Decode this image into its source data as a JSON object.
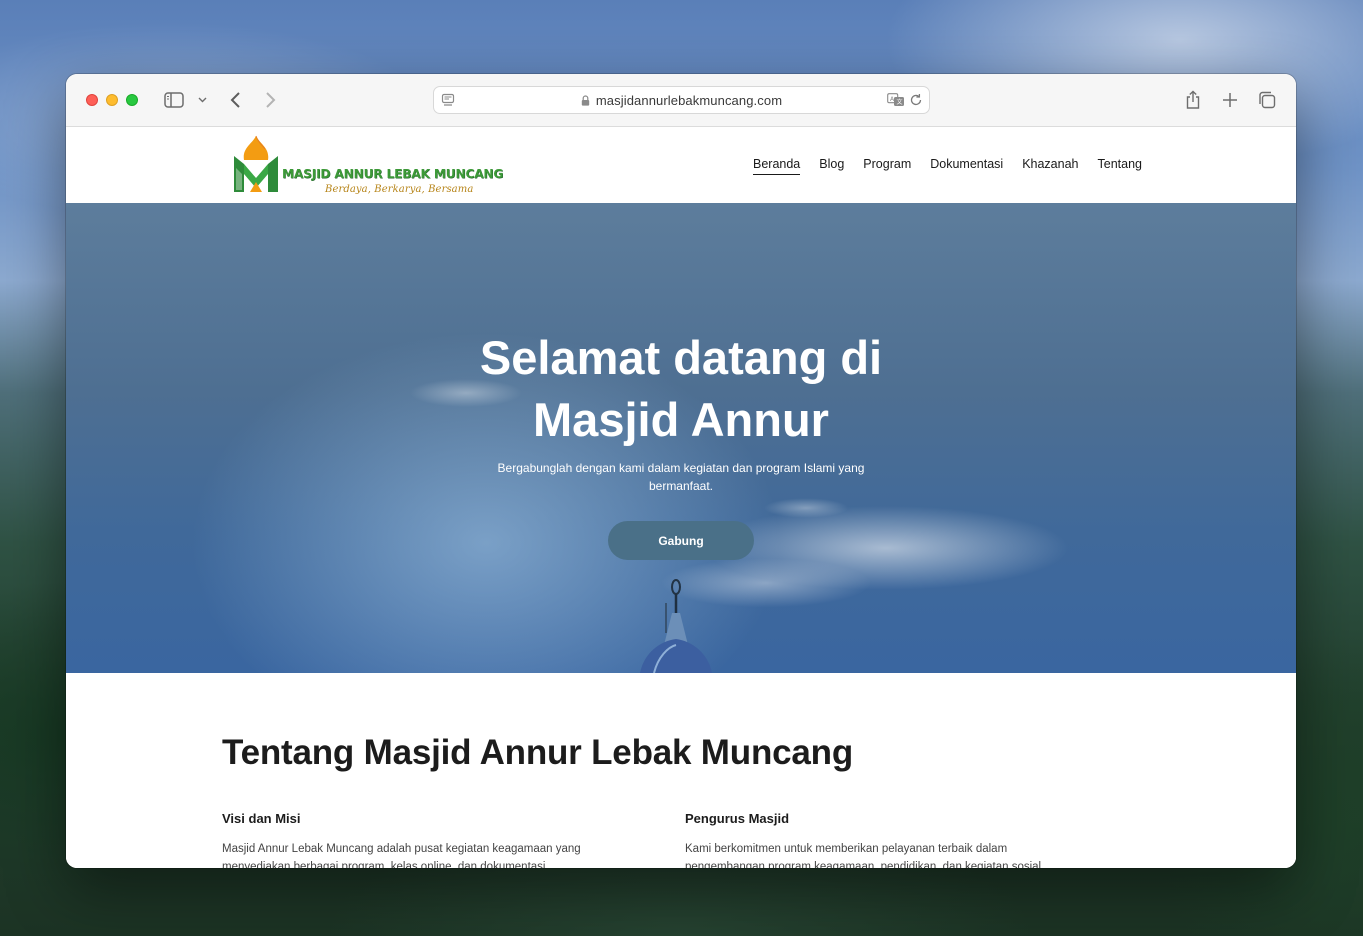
{
  "browser": {
    "url": "masjidannurlebakmuncang.com"
  },
  "site": {
    "brand_name": "MASJID ANNUR LEBAK MUNCANG",
    "brand_tagline": "Berdaya, Berkarya, Bersama",
    "nav": [
      {
        "label": "Beranda",
        "active": true
      },
      {
        "label": "Blog",
        "active": false
      },
      {
        "label": "Program",
        "active": false
      },
      {
        "label": "Dokumentasi",
        "active": false
      },
      {
        "label": "Khazanah",
        "active": false
      },
      {
        "label": "Tentang",
        "active": false
      }
    ]
  },
  "hero": {
    "title_line1": "Selamat datang di",
    "title_line2": "Masjid Annur",
    "subtitle_line1": "Bergabunglah dengan kami dalam kegiatan dan program Islami yang",
    "subtitle_line2": "bermanfaat.",
    "cta": "Gabung"
  },
  "about": {
    "heading": "Tentang Masjid Annur Lebak Muncang",
    "left": {
      "title": "Visi dan Misi",
      "text": "Masjid Annur Lebak Muncang adalah pusat kegiatan keagamaan yang menyediakan berbagai program, kelas online, dan dokumentasi"
    },
    "right": {
      "title": "Pengurus Masjid",
      "text": "Kami berkomitmen untuk memberikan pelayanan terbaik dalam pengembangan program keagamaan, pendidikan, dan kegiatan sosial"
    }
  },
  "colors": {
    "brand_green": "#3d9a38",
    "brand_orange": "#f39c12",
    "hero_button": "#4a7088"
  },
  "icons": [
    "sidebar-icon",
    "chevron-down-icon",
    "back-arrow-icon",
    "forward-arrow-icon",
    "page-icon",
    "lock-icon",
    "translate-icon",
    "reload-icon",
    "share-icon",
    "plus-icon",
    "tabs-overview-icon"
  ]
}
